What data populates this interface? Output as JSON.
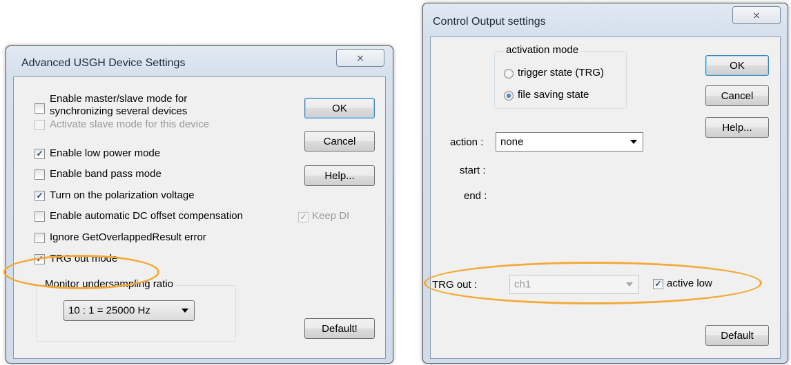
{
  "left_dialog": {
    "title": "Advanced USGH Device Settings",
    "close_glyph": "⨯",
    "options": {
      "master_slave_line1": "Enable master/slave mode for",
      "master_slave_line2": "synchronizing several devices",
      "master_slave_checked": false,
      "activate_slave": "Activate slave mode for this device",
      "activate_slave_checked": false,
      "low_power": "Enable low power mode",
      "low_power_checked": true,
      "band_pass": "Enable band pass mode",
      "band_pass_checked": false,
      "polarization": "Turn on the polarization voltage",
      "polarization_checked": true,
      "dc_offset": "Enable automatic DC offset compensation",
      "dc_offset_checked": false,
      "keep_di": "Keep DI",
      "keep_di_checked": true,
      "ignore_error": "Ignore GetOverlappedResult error",
      "ignore_error_checked": false,
      "trg_out_mode": "TRG out mode",
      "trg_out_mode_checked": true
    },
    "monitor_group": {
      "label": "Monitor undersampling ratio",
      "selected": "10 : 1 = 25000 Hz"
    },
    "buttons": {
      "ok": "OK",
      "cancel": "Cancel",
      "help": "Help...",
      "default": "Default!"
    }
  },
  "right_dialog": {
    "title": "Control Output settings",
    "close_glyph": "⨯",
    "activation_group": {
      "label": "activation mode",
      "option_trigger": "trigger state (TRG)",
      "option_file": "file saving state",
      "selected": "file saving state"
    },
    "action_label": "action :",
    "action_value": "none",
    "start_label": "start :",
    "end_label": "end :",
    "trg_out_label": "TRG out :",
    "trg_out_value": "ch1",
    "active_low": "active low",
    "active_low_checked": true,
    "buttons": {
      "ok": "OK",
      "cancel": "Cancel",
      "help": "Help...",
      "default": "Default"
    }
  },
  "colors": {
    "highlight": "#f3a934",
    "checkmark": "#1f3f8a",
    "default_button_border": "#3c7fb1"
  }
}
